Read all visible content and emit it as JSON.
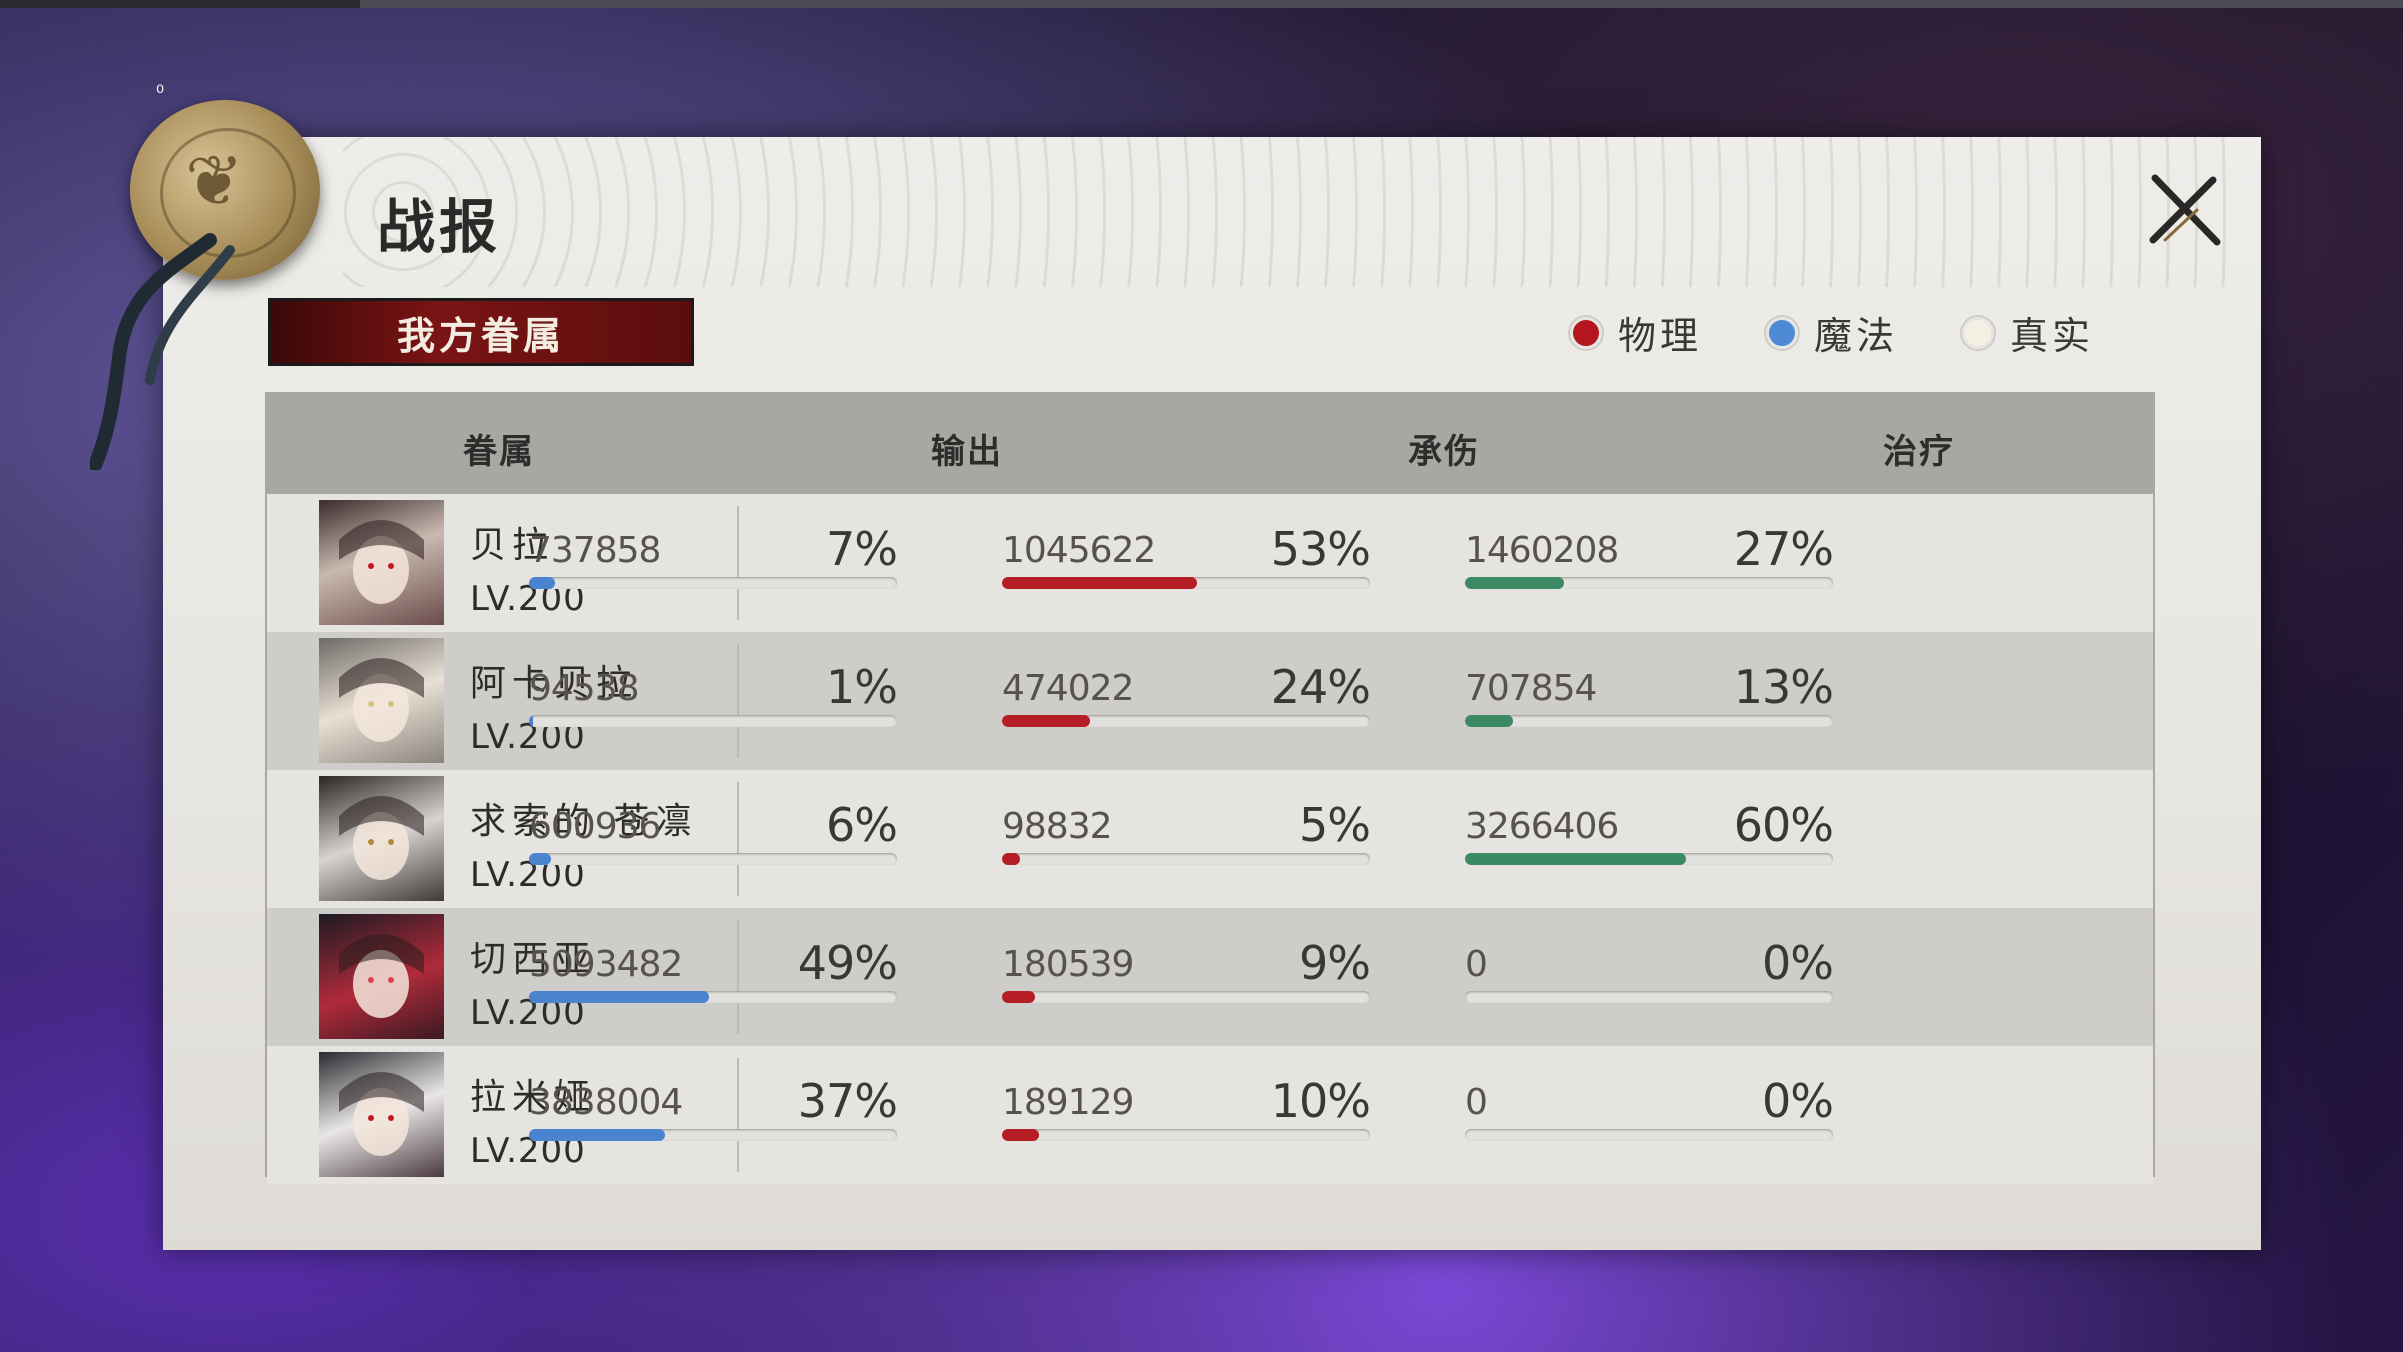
{
  "status": {
    "indicator": "₀"
  },
  "window": {
    "title": "战报"
  },
  "tab": {
    "label": "我方眷属"
  },
  "legend": [
    {
      "label": "物理",
      "color": "#b3161f"
    },
    {
      "label": "魔法",
      "color": "#4f8ad6"
    },
    {
      "label": "真实",
      "color": "#f3efe3"
    }
  ],
  "colors": {
    "damage_bar": "#4a84cf",
    "taken_bar": "#b51e24",
    "heal_bar": "#3c8a63"
  },
  "table": {
    "headers": [
      "眷属",
      "输出",
      "承伤",
      "治疗"
    ],
    "rows": [
      {
        "name": "贝拉",
        "level": "LV.200",
        "output": {
          "value": "737858",
          "pct": "7%"
        },
        "taken": {
          "value": "1045622",
          "pct": "53%"
        },
        "heal": {
          "value": "1460208",
          "pct": "27%"
        }
      },
      {
        "name": "阿卡贝拉",
        "level": "LV.200",
        "output": {
          "value": "94538",
          "pct": "1%"
        },
        "taken": {
          "value": "474022",
          "pct": "24%"
        },
        "heal": {
          "value": "707854",
          "pct": "13%"
        }
      },
      {
        "name": "求索的 苍凛",
        "level": "LV.200",
        "output": {
          "value": "600936",
          "pct": "6%"
        },
        "taken": {
          "value": "98832",
          "pct": "5%"
        },
        "heal": {
          "value": "3266406",
          "pct": "60%"
        }
      },
      {
        "name": "切西亚",
        "level": "LV.200",
        "output": {
          "value": "5093482",
          "pct": "49%"
        },
        "taken": {
          "value": "180539",
          "pct": "9%"
        },
        "heal": {
          "value": "0",
          "pct": "0%"
        }
      },
      {
        "name": "拉米娅",
        "level": "LV.200",
        "output": {
          "value": "3838004",
          "pct": "37%"
        },
        "taken": {
          "value": "189129",
          "pct": "10%"
        },
        "heal": {
          "value": "0",
          "pct": "0%"
        }
      }
    ]
  }
}
